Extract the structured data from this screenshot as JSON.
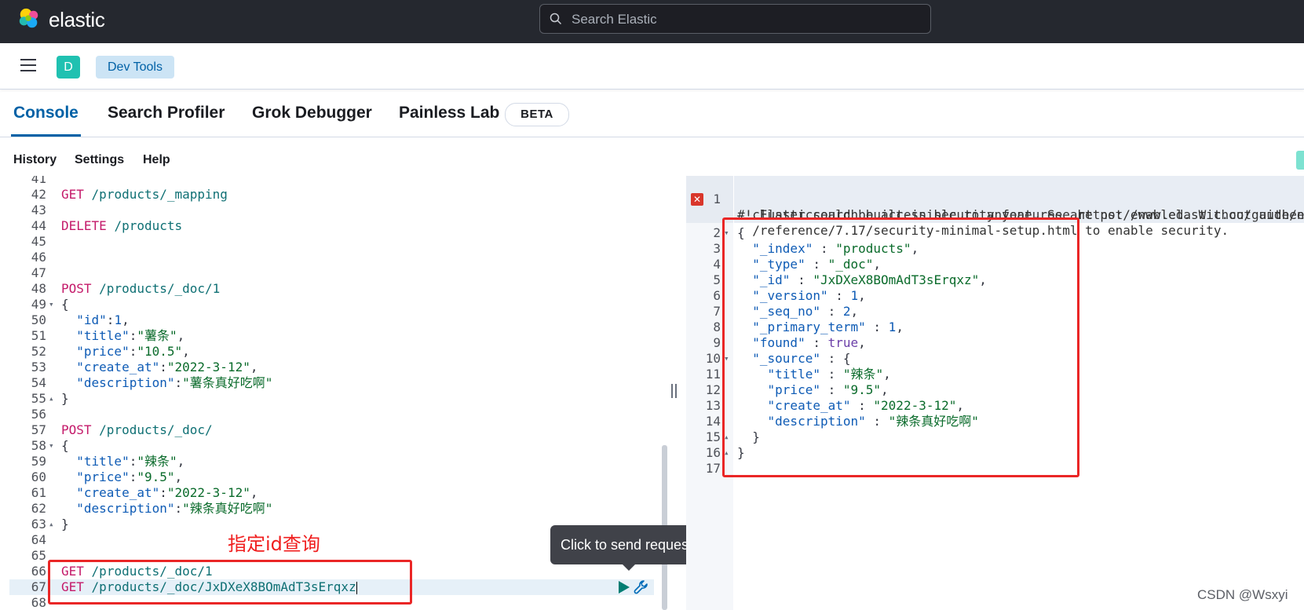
{
  "header": {
    "brand": "elastic",
    "search_placeholder": "Search Elastic"
  },
  "subheader": {
    "space_initial": "D",
    "breadcrumb": "Dev Tools"
  },
  "tabs": [
    {
      "label": "Console",
      "active": true
    },
    {
      "label": "Search Profiler"
    },
    {
      "label": "Grok Debugger"
    },
    {
      "label": "Painless Lab"
    }
  ],
  "beta_badge": "BETA",
  "toolbar": [
    "History",
    "Settings",
    "Help"
  ],
  "editor": {
    "lines": [
      {
        "n": "41",
        "fold": "",
        "segs": []
      },
      {
        "n": "42",
        "fold": "",
        "segs": [
          [
            "method",
            "GET"
          ],
          [
            "p",
            " "
          ],
          [
            "url",
            "/products/_mapping"
          ]
        ]
      },
      {
        "n": "43",
        "fold": "",
        "segs": []
      },
      {
        "n": "44",
        "fold": "",
        "segs": [
          [
            "method",
            "DELETE"
          ],
          [
            "p",
            " "
          ],
          [
            "url",
            "/products"
          ]
        ]
      },
      {
        "n": "45",
        "fold": "",
        "segs": []
      },
      {
        "n": "46",
        "fold": "",
        "segs": []
      },
      {
        "n": "47",
        "fold": "",
        "segs": []
      },
      {
        "n": "48",
        "fold": "",
        "segs": [
          [
            "method",
            "POST"
          ],
          [
            "p",
            " "
          ],
          [
            "url",
            "/products/_doc/1"
          ]
        ]
      },
      {
        "n": "49",
        "fold": "▾",
        "segs": [
          [
            "p",
            "{"
          ]
        ]
      },
      {
        "n": "50",
        "fold": "",
        "segs": [
          [
            "p",
            "  "
          ],
          [
            "key",
            "\"id\""
          ],
          [
            "p",
            ":"
          ],
          [
            "num",
            "1"
          ],
          [
            "p",
            ","
          ]
        ]
      },
      {
        "n": "51",
        "fold": "",
        "segs": [
          [
            "p",
            "  "
          ],
          [
            "key",
            "\"title\""
          ],
          [
            "p",
            ":"
          ],
          [
            "str",
            "\"薯条\""
          ],
          [
            "p",
            ","
          ]
        ]
      },
      {
        "n": "52",
        "fold": "",
        "segs": [
          [
            "p",
            "  "
          ],
          [
            "key",
            "\"price\""
          ],
          [
            "p",
            ":"
          ],
          [
            "str",
            "\"10.5\""
          ],
          [
            "p",
            ","
          ]
        ]
      },
      {
        "n": "53",
        "fold": "",
        "segs": [
          [
            "p",
            "  "
          ],
          [
            "key",
            "\"create_at\""
          ],
          [
            "p",
            ":"
          ],
          [
            "str",
            "\"2022-3-12\""
          ],
          [
            "p",
            ","
          ]
        ]
      },
      {
        "n": "54",
        "fold": "",
        "segs": [
          [
            "p",
            "  "
          ],
          [
            "key",
            "\"description\""
          ],
          [
            "p",
            ":"
          ],
          [
            "str",
            "\"薯条真好吃啊\""
          ]
        ]
      },
      {
        "n": "55",
        "fold": "▴",
        "segs": [
          [
            "p",
            "}"
          ]
        ]
      },
      {
        "n": "56",
        "fold": "",
        "segs": []
      },
      {
        "n": "57",
        "fold": "",
        "segs": [
          [
            "method",
            "POST"
          ],
          [
            "p",
            " "
          ],
          [
            "url",
            "/products/_doc/"
          ]
        ]
      },
      {
        "n": "58",
        "fold": "▾",
        "segs": [
          [
            "p",
            "{"
          ]
        ]
      },
      {
        "n": "59",
        "fold": "",
        "segs": [
          [
            "p",
            "  "
          ],
          [
            "key",
            "\"title\""
          ],
          [
            "p",
            ":"
          ],
          [
            "str",
            "\"辣条\""
          ],
          [
            "p",
            ","
          ]
        ]
      },
      {
        "n": "60",
        "fold": "",
        "segs": [
          [
            "p",
            "  "
          ],
          [
            "key",
            "\"price\""
          ],
          [
            "p",
            ":"
          ],
          [
            "str",
            "\"9.5\""
          ],
          [
            "p",
            ","
          ]
        ]
      },
      {
        "n": "61",
        "fold": "",
        "segs": [
          [
            "p",
            "  "
          ],
          [
            "key",
            "\"create_at\""
          ],
          [
            "p",
            ":"
          ],
          [
            "str",
            "\"2022-3-12\""
          ],
          [
            "p",
            ","
          ]
        ]
      },
      {
        "n": "62",
        "fold": "",
        "segs": [
          [
            "p",
            "  "
          ],
          [
            "key",
            "\"description\""
          ],
          [
            "p",
            ":"
          ],
          [
            "str",
            "\"辣条真好吃啊\""
          ]
        ]
      },
      {
        "n": "63",
        "fold": "▴",
        "segs": [
          [
            "p",
            "}"
          ]
        ]
      },
      {
        "n": "64",
        "fold": "",
        "segs": []
      },
      {
        "n": "65",
        "fold": "",
        "segs": []
      },
      {
        "n": "66",
        "fold": "",
        "segs": [
          [
            "method",
            "GET"
          ],
          [
            "p",
            " "
          ],
          [
            "url",
            "/products/_doc/1"
          ]
        ]
      },
      {
        "n": "67",
        "fold": "",
        "highlight": true,
        "cursor": true,
        "segs": [
          [
            "method",
            "GET"
          ],
          [
            "p",
            " "
          ],
          [
            "url",
            "/products/_doc/JxDXeX8BOmAdT3sErqxz"
          ]
        ]
      },
      {
        "n": "68",
        "fold": "",
        "segs": []
      }
    ]
  },
  "tooltip": "Click to send request",
  "annotation": "指定id查询",
  "output": {
    "warning_line_no": "1",
    "warning": [
      "#! Elasticsearch built-in security features are not enabled. Without authen",
      "  cluster could be accessible to anyone. See https://www.elastic.co/guide/e",
      "  /reference/7.17/security-minimal-setup.html to enable security."
    ],
    "lines": [
      {
        "n": "2",
        "fold": "▾",
        "segs": [
          [
            "p",
            "{"
          ]
        ]
      },
      {
        "n": "3",
        "fold": "",
        "segs": [
          [
            "p",
            "  "
          ],
          [
            "key",
            "\"_index\""
          ],
          [
            "p",
            " : "
          ],
          [
            "str",
            "\"products\""
          ],
          [
            "p",
            ","
          ]
        ]
      },
      {
        "n": "4",
        "fold": "",
        "segs": [
          [
            "p",
            "  "
          ],
          [
            "key",
            "\"_type\""
          ],
          [
            "p",
            " : "
          ],
          [
            "str",
            "\"_doc\""
          ],
          [
            "p",
            ","
          ]
        ]
      },
      {
        "n": "5",
        "fold": "",
        "segs": [
          [
            "p",
            "  "
          ],
          [
            "key",
            "\"_id\""
          ],
          [
            "p",
            " : "
          ],
          [
            "str",
            "\"JxDXeX8BOmAdT3sErqxz\""
          ],
          [
            "p",
            ","
          ]
        ]
      },
      {
        "n": "6",
        "fold": "",
        "segs": [
          [
            "p",
            "  "
          ],
          [
            "key",
            "\"_version\""
          ],
          [
            "p",
            " : "
          ],
          [
            "num",
            "1"
          ],
          [
            "p",
            ","
          ]
        ]
      },
      {
        "n": "7",
        "fold": "",
        "segs": [
          [
            "p",
            "  "
          ],
          [
            "key",
            "\"_seq_no\""
          ],
          [
            "p",
            " : "
          ],
          [
            "num",
            "2"
          ],
          [
            "p",
            ","
          ]
        ]
      },
      {
        "n": "8",
        "fold": "",
        "segs": [
          [
            "p",
            "  "
          ],
          [
            "key",
            "\"_primary_term\""
          ],
          [
            "p",
            " : "
          ],
          [
            "num",
            "1"
          ],
          [
            "p",
            ","
          ]
        ]
      },
      {
        "n": "9",
        "fold": "",
        "segs": [
          [
            "p",
            "  "
          ],
          [
            "key",
            "\"found\""
          ],
          [
            "p",
            " : "
          ],
          [
            "bool",
            "true"
          ],
          [
            "p",
            ","
          ]
        ]
      },
      {
        "n": "10",
        "fold": "▾",
        "segs": [
          [
            "p",
            "  "
          ],
          [
            "key",
            "\"_source\""
          ],
          [
            "p",
            " : {"
          ]
        ]
      },
      {
        "n": "11",
        "fold": "",
        "segs": [
          [
            "p",
            "    "
          ],
          [
            "key",
            "\"title\""
          ],
          [
            "p",
            " : "
          ],
          [
            "str",
            "\"辣条\""
          ],
          [
            "p",
            ","
          ]
        ]
      },
      {
        "n": "12",
        "fold": "",
        "segs": [
          [
            "p",
            "    "
          ],
          [
            "key",
            "\"price\""
          ],
          [
            "p",
            " : "
          ],
          [
            "str",
            "\"9.5\""
          ],
          [
            "p",
            ","
          ]
        ]
      },
      {
        "n": "13",
        "fold": "",
        "segs": [
          [
            "p",
            "    "
          ],
          [
            "key",
            "\"create_at\""
          ],
          [
            "p",
            " : "
          ],
          [
            "str",
            "\"2022-3-12\""
          ],
          [
            "p",
            ","
          ]
        ]
      },
      {
        "n": "14",
        "fold": "",
        "segs": [
          [
            "p",
            "    "
          ],
          [
            "key",
            "\"description\""
          ],
          [
            "p",
            " : "
          ],
          [
            "str",
            "\"辣条真好吃啊\""
          ]
        ]
      },
      {
        "n": "15",
        "fold": "▴",
        "segs": [
          [
            "p",
            "  }"
          ]
        ]
      },
      {
        "n": "16",
        "fold": "▴",
        "segs": [
          [
            "p",
            "}"
          ]
        ]
      },
      {
        "n": "17",
        "fold": "",
        "segs": []
      }
    ]
  },
  "watermark": "CSDN @Wsxyi",
  "colors": {
    "topbar": "#25282f",
    "accent": "#0061a6",
    "method": "#c41a6a",
    "url": "#0f7074",
    "key": "#0e5bb5",
    "string": "#0a6b2b",
    "annotation_red": "#ea2626"
  }
}
